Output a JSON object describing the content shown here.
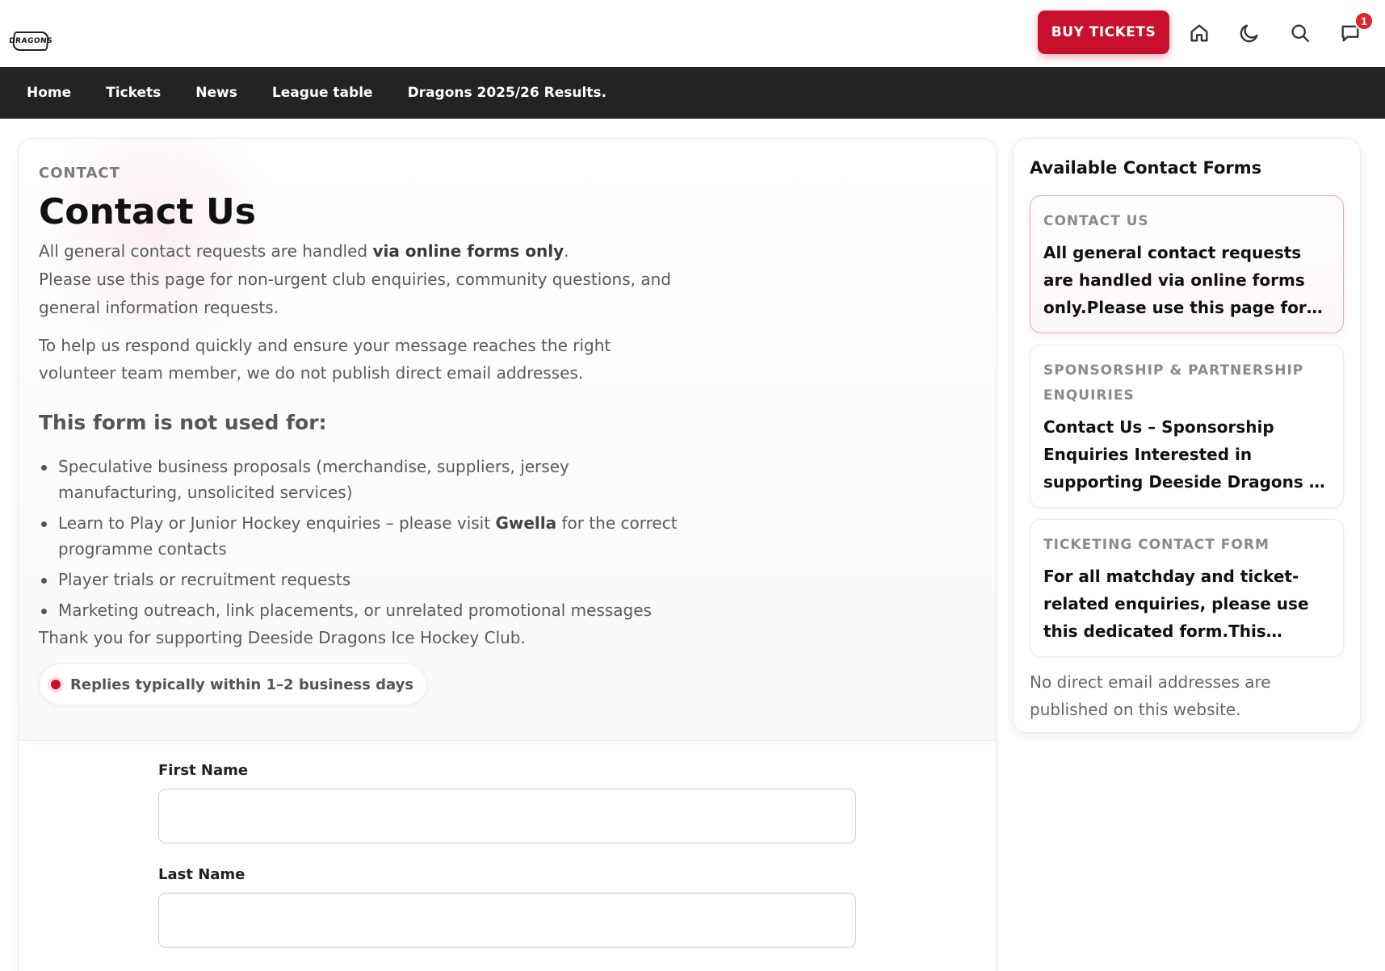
{
  "header": {
    "logo_text": "DRAGONS",
    "buy_tickets_label": "BUY TICKETS",
    "icons": [
      "home-icon",
      "moon-icon",
      "search-icon",
      "chat-icon"
    ],
    "notification_count": "1",
    "accent_color": "#c8102e"
  },
  "nav": {
    "items": [
      {
        "label": "Home"
      },
      {
        "label": "Tickets"
      },
      {
        "label": "News"
      },
      {
        "label": "League table"
      },
      {
        "label": "Dragons 2025/26 Results."
      }
    ]
  },
  "main": {
    "eyebrow": "CONTACT",
    "title": "Contact Us",
    "intro_1_pre": "All general contact requests are handled ",
    "intro_1_bold": "via online forms only",
    "intro_1_post": ".",
    "intro_2": "Please use this page for non-urgent club enquiries, community questions, and general information requests.",
    "intro_3": "To help us respond quickly and ensure your message reaches the right volunteer team member, we do not publish direct email addresses.",
    "not_used_heading": "This form is not used for:",
    "bullets": {
      "b1": "Speculative business proposals (merchandise, suppliers, jersey manufacturing, unsolicited services)",
      "b2_pre": "Learn to Play or Junior Hockey enquiries – please visit ",
      "b2_bold": "Gwella",
      "b2_post": " for the correct programme contacts",
      "b3": "Player trials or recruitment requests",
      "b4": "Marketing outreach, link placements, or unrelated promotional messages"
    },
    "thanks": "Thank you for supporting Deeside Dragons Ice Hockey Club.",
    "reply_note": "Replies typically within 1–2 business days",
    "form": {
      "first_name_label": "First Name",
      "first_name_value": "",
      "last_name_label": "Last Name",
      "last_name_value": ""
    }
  },
  "sidebar": {
    "title": "Available Contact Forms",
    "forms": [
      {
        "eyebrow": "CONTACT US",
        "description": "All general contact requests are handled via online forms only.Please use this page for non..."
      },
      {
        "eyebrow": "SPONSORSHIP & PARTNERSHIP ENQUIRIES",
        "description": "Contact Us – Sponsorship Enquiries Interested in supporting Deeside Dragons as a sponsor or partner?..."
      },
      {
        "eyebrow": "TICKETING CONTACT FORM",
        "description": "For all matchday and ticket-related enquiries, please use this dedicated form.This includes..."
      }
    ],
    "note": "No direct email addresses are published on this website."
  }
}
